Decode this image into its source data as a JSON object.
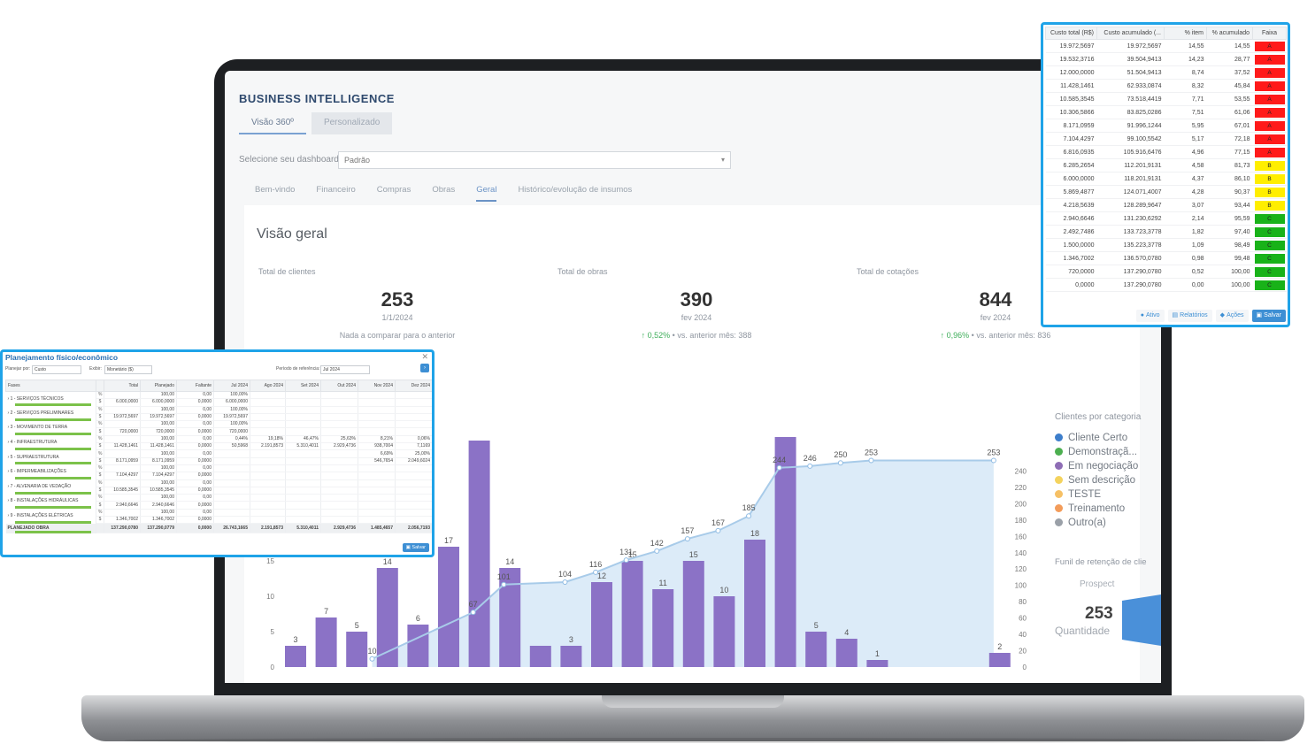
{
  "bi": {
    "title": "BUSINESS INTELLIGENCE",
    "tabs": [
      "Visão 360º",
      "Personalizado"
    ],
    "dashboard_label": "Selecione seu dashboard",
    "dashboard_value": "Padrão",
    "sub_tabs": [
      "Bem-vindo",
      "Financeiro",
      "Compras",
      "Obras",
      "Geral",
      "Histórico/evolução de insumos"
    ],
    "active_sub_tab": "Geral",
    "overview_title": "Visão geral"
  },
  "kpis": [
    {
      "label": "Total de clientes",
      "value": "253",
      "date": "1/1/2024",
      "note": "Nada a comparar para o anterior",
      "delta": ""
    },
    {
      "label": "Total de obras",
      "value": "390",
      "date": "fev 2024",
      "delta": "0,52%",
      "note": "vs. anterior mês: 388"
    },
    {
      "label": "Total de cotações",
      "value": "844",
      "date": "fev 2024",
      "delta": "0,96%",
      "note": "vs. anterior mês: 836"
    }
  ],
  "legend": {
    "title": "Clientes por categoria",
    "items": [
      {
        "label": "Cliente Certo",
        "color": "#3d7ecb"
      },
      {
        "label": "Demonstraçã...",
        "color": "#4caf50"
      },
      {
        "label": "Em negociação",
        "color": "#8e6db5"
      },
      {
        "label": "Sem descrição",
        "color": "#f4d35e"
      },
      {
        "label": "TESTE",
        "color": "#f6c065"
      },
      {
        "label": "Treinamento",
        "color": "#f39c5a"
      },
      {
        "label": "Outro(a)",
        "color": "#9aa0a8"
      }
    ]
  },
  "funnel": {
    "title": "Funil de retenção de clie",
    "stage": "Prospect",
    "value": "253",
    "sub": "Quantidade"
  },
  "chart_data": {
    "type": "bar",
    "title": "",
    "bars": [
      3,
      7,
      5,
      14,
      6,
      17,
      32,
      14,
      3,
      3,
      12,
      15,
      11,
      15,
      10,
      18,
      84,
      5,
      4,
      1,
      2
    ],
    "bar_x": [
      0,
      1,
      2,
      3,
      4,
      5,
      6,
      7,
      8,
      9,
      10,
      11,
      12,
      13,
      14,
      15,
      16,
      17,
      18,
      19,
      23
    ],
    "bar_labels_left": [
      "3",
      "7",
      "5",
      "14",
      "6",
      "17",
      "32",
      "14",
      "",
      "3",
      "12",
      "15",
      "11",
      "15",
      "10",
      "18",
      "84",
      "5",
      "4",
      "1",
      "2"
    ],
    "cumulative_points": [
      {
        "x": 2.5,
        "v": 10
      },
      {
        "x": 5.8,
        "v": 67
      },
      {
        "x": 6.8,
        "v": 101
      },
      {
        "x": 8.8,
        "v": 104
      },
      {
        "x": 9.8,
        "v": 116
      },
      {
        "x": 10.8,
        "v": 131
      },
      {
        "x": 11.8,
        "v": 142
      },
      {
        "x": 12.8,
        "v": 157
      },
      {
        "x": 13.8,
        "v": 167
      },
      {
        "x": 14.8,
        "v": 185
      },
      {
        "x": 15.8,
        "v": 244
      },
      {
        "x": 16.8,
        "v": 246
      },
      {
        "x": 17.8,
        "v": 250
      },
      {
        "x": 18.8,
        "v": 253
      },
      {
        "x": 22.8,
        "v": 253
      }
    ],
    "cumulative_labels": [
      "10",
      "67",
      "101",
      "104",
      "116",
      "131",
      "142",
      "157",
      "167",
      "185",
      "244",
      "246",
      "250",
      "253",
      "253"
    ],
    "left_ticks": [
      "25",
      "20",
      "15",
      "10",
      "5",
      "0"
    ],
    "right_ticks": [
      "240",
      "220",
      "200",
      "180",
      "160",
      "140",
      "120",
      "100",
      "80",
      "60",
      "40",
      "20",
      "0"
    ],
    "left_ylim": [
      0,
      30
    ],
    "right_ylim": [
      0,
      260
    ]
  },
  "plan": {
    "title": "Planejamento físico/econômico",
    "filters": {
      "plan_by_label": "Planejar por:",
      "plan_by_value": "Custo",
      "show_label": "Exibir:",
      "show_value": "Monetário ($)",
      "period_label": "Período de referência:",
      "period_value": "Jul 2024"
    },
    "columns": [
      "Fases",
      "",
      "Total",
      "Planejado",
      "Faltante",
      "Jul 2024",
      "Ago 2024",
      "Set 2024",
      "Out 2024",
      "Nov 2024",
      "Dez 2024"
    ],
    "rows": [
      {
        "phase": "1 - SERVIÇOS TÉCNICOS",
        "pct": [
          "",
          "100,00",
          "0,00",
          "100,00%",
          "",
          "",
          "",
          "",
          ""
        ],
        "val": [
          "6.000,0000",
          "6.000,0000",
          "0,0000",
          "6.000,0000",
          "",
          "",
          "",
          "",
          ""
        ]
      },
      {
        "phase": "2 - SERVIÇOS PRELIMINARES",
        "pct": [
          "",
          "100,00",
          "0,00",
          "100,00%",
          "",
          "",
          "",
          "",
          ""
        ],
        "val": [
          "19.972,5697",
          "19.972,5697",
          "0,0000",
          "19.972,5697",
          "",
          "",
          "",
          "",
          ""
        ]
      },
      {
        "phase": "3 - MOVIMENTO DE TERRA",
        "pct": [
          "",
          "100,00",
          "0,00",
          "100,00%",
          "",
          "",
          "",
          "",
          ""
        ],
        "val": [
          "720,0000",
          "720,0000",
          "0,0000",
          "720,0000",
          "",
          "",
          "",
          "",
          ""
        ]
      },
      {
        "phase": "4 - INFRAESTRUTURA",
        "pct": [
          "",
          "100,00",
          "0,00",
          "0,44%",
          "19,18%",
          "46,47%",
          "25,63%",
          "8,21%",
          "0,06%"
        ],
        "val": [
          "11.428,1461",
          "11.428,1461",
          "0,0000",
          "50,5968",
          "2.191,8573",
          "5.310,4011",
          "2.929,4736",
          "938,7004",
          "7,1169"
        ]
      },
      {
        "phase": "5 - SUPRAESTRUTURA",
        "pct": [
          "",
          "100,00",
          "0,00",
          "",
          "",
          "",
          "",
          "6,69%",
          "25,00%"
        ],
        "val": [
          "8.171,0959",
          "8.171,0959",
          "0,0000",
          "",
          "",
          "",
          "",
          "546,7654",
          "2.049,6024"
        ]
      },
      {
        "phase": "6 - IMPERMEABILIZAÇÕES",
        "pct": [
          "",
          "100,00",
          "0,00",
          "",
          "",
          "",
          "",
          "",
          ""
        ],
        "val": [
          "7.104,4297",
          "7.104,4297",
          "0,0000",
          "",
          "",
          "",
          "",
          "",
          ""
        ]
      },
      {
        "phase": "7 - ALVENARIA DE VEDAÇÃO",
        "pct": [
          "",
          "100,00",
          "0,00",
          "",
          "",
          "",
          "",
          "",
          ""
        ],
        "val": [
          "10.585,3545",
          "10.585,3545",
          "0,0000",
          "",
          "",
          "",
          "",
          "",
          ""
        ]
      },
      {
        "phase": "8 - INSTALAÇÕES HIDRÁULICAS",
        "pct": [
          "",
          "100,00",
          "0,00",
          "",
          "",
          "",
          "",
          "",
          ""
        ],
        "val": [
          "2.940,6646",
          "2.940,6646",
          "0,0000",
          "",
          "",
          "",
          "",
          "",
          ""
        ]
      },
      {
        "phase": "9 - INSTALAÇÕES ELÉTRICAS",
        "pct": [
          "",
          "100,00",
          "0,00",
          "",
          "",
          "",
          "",
          "",
          ""
        ],
        "val": [
          "1.346,7002",
          "1.346,7002",
          "0,0000",
          "",
          "",
          "",
          "",
          "",
          ""
        ]
      }
    ],
    "total_row": {
      "phase": "PLANEJADO OBRA",
      "values": [
        "137.290,0780",
        "137.290,0779",
        "0,0000",
        "26.743,1665",
        "2.191,8573",
        "5.310,4011",
        "2.929,4736",
        "1.485,4657",
        "2.056,7193"
      ]
    },
    "unit_pct": "%",
    "unit_val": "$",
    "save_label": "Salvar"
  },
  "cost": {
    "columns": [
      "Custo total (R$)",
      "Custo acumulado (...",
      "% item",
      "% acumulado",
      "Faixa"
    ],
    "rows": [
      [
        "19.972,5697",
        "19.972,5697",
        "14,55",
        "14,55",
        "A"
      ],
      [
        "19.532,3716",
        "39.504,9413",
        "14,23",
        "28,77",
        "A"
      ],
      [
        "12.000,0000",
        "51.504,9413",
        "8,74",
        "37,52",
        "A"
      ],
      [
        "11.428,1461",
        "62.933,0874",
        "8,32",
        "45,84",
        "A"
      ],
      [
        "10.585,3545",
        "73.518,4419",
        "7,71",
        "53,55",
        "A"
      ],
      [
        "10.306,5866",
        "83.825,0286",
        "7,51",
        "61,06",
        "A"
      ],
      [
        "8.171,0959",
        "91.996,1244",
        "5,95",
        "67,01",
        "A"
      ],
      [
        "7.104,4297",
        "99.100,5542",
        "5,17",
        "72,18",
        "A"
      ],
      [
        "6.816,0935",
        "105.916,6476",
        "4,96",
        "77,15",
        "A"
      ],
      [
        "6.285,2654",
        "112.201,9131",
        "4,58",
        "81,73",
        "B"
      ],
      [
        "6.000,0000",
        "118.201,9131",
        "4,37",
        "86,10",
        "B"
      ],
      [
        "5.869,4877",
        "124.071,4007",
        "4,28",
        "90,37",
        "B"
      ],
      [
        "4.218,5639",
        "128.289,9647",
        "3,07",
        "93,44",
        "B"
      ],
      [
        "2.940,6646",
        "131.230,6292",
        "2,14",
        "95,59",
        "C"
      ],
      [
        "2.492,7486",
        "133.723,3778",
        "1,82",
        "97,40",
        "C"
      ],
      [
        "1.500,0000",
        "135.223,3778",
        "1,09",
        "98,49",
        "C"
      ],
      [
        "1.346,7002",
        "136.570,0780",
        "0,98",
        "99,48",
        "C"
      ],
      [
        "720,0000",
        "137.290,0780",
        "0,52",
        "100,00",
        "C"
      ],
      [
        "0,0000",
        "137.290,0780",
        "0,00",
        "100,00",
        "C"
      ]
    ],
    "band_colors": {
      "A": "#ff1a1a",
      "B": "#ffee00",
      "C": "#19b219"
    },
    "buttons": [
      {
        "label": "Ativo",
        "icon": "circle-icon"
      },
      {
        "label": "Relatórios",
        "icon": "report-icon"
      },
      {
        "label": "Ações",
        "icon": "actions-icon"
      },
      {
        "label": "Salvar",
        "icon": "save-icon"
      }
    ]
  }
}
